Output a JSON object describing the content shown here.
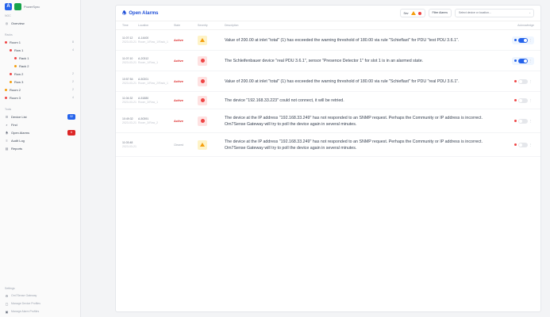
{
  "brand": {
    "name": "PowerSync"
  },
  "sidebar": {
    "sec1": "NOC",
    "overview": "Overview",
    "sec2": "Racks",
    "tree": [
      {
        "label": "Room 1",
        "indent": 0,
        "dot": "#ef4444",
        "count": "8"
      },
      {
        "label": "Row 1",
        "indent": 1,
        "dot": "#ef4444",
        "count": "4"
      },
      {
        "label": "Rack 1",
        "indent": 2,
        "dot": "#ef4444",
        "count": ""
      },
      {
        "label": "Rack 2",
        "indent": 2,
        "dot": "#f59e0b",
        "count": ""
      },
      {
        "label": "Row 2",
        "indent": 1,
        "dot": "#ef4444",
        "count": "2"
      },
      {
        "label": "Row 3",
        "indent": 1,
        "dot": "#f59e0b",
        "count": "2"
      },
      {
        "label": "Room 2",
        "indent": 0,
        "dot": "#f59e0b",
        "count": "2"
      },
      {
        "label": "Room 3",
        "indent": 0,
        "dot": "#ef4444",
        "count": "4"
      }
    ],
    "sec3": "Tools",
    "tools": [
      {
        "label": "Device List",
        "icon": "list-icon",
        "badge": "32",
        "badgeColor": "#2563eb"
      },
      {
        "label": "Find",
        "icon": "search-icon",
        "badge": "",
        "badgeColor": ""
      },
      {
        "label": "Open Alarms",
        "icon": "bell-icon",
        "badge": "6",
        "badgeColor": "#dc2626"
      },
      {
        "label": "Audit Log",
        "icon": "log-icon",
        "badge": "",
        "badgeColor": ""
      },
      {
        "label": "Reports",
        "icon": "report-icon",
        "badge": "",
        "badgeColor": ""
      }
    ],
    "sec4": "Settings",
    "footer": [
      "Om7Sense Gateway",
      "Manage Device Profiles",
      "Manage Alarm Profiles"
    ]
  },
  "header": {
    "title": "Open Alarms",
    "severity_label": "Sev",
    "filter_label": "Filter Alarms",
    "search_placeholder": "Select device or location..."
  },
  "table": {
    "columns": [
      "Time",
      "Location",
      "State",
      "Severity",
      "Description",
      "Acknowledge"
    ],
    "rows": [
      {
        "time": "11:07:12",
        "date": "2023-03-21",
        "loc": "A-14400",
        "locsub": "Room_1/Row_1/Rack_1",
        "state": "Active",
        "severity": "warning",
        "desc": "Value of 200.00 at inlet \"total\" (1) has exceeded the warning threshold of 180.00 via rule \"Schieflast\" for PDU \"test PDU 3.6.1\".",
        "ack": true
      },
      {
        "time": "11:07:10",
        "date": "2023-03-21",
        "loc": "A-20312",
        "locsub": "Room_1/Row_1",
        "state": "Active",
        "severity": "critical",
        "desc": "The Schleifenbauer device \"real PDU 3.6.1\", sensor \"Presence Detector 1\" for slot 1 is in an alarmed state.",
        "ack": true
      },
      {
        "time": "10:57:54",
        "date": "2023-03-21",
        "loc": "A-50201",
        "locsub": "Room_1/Row_2/Rack_1",
        "state": "Active",
        "severity": "critical",
        "desc": "Value of 200.00 at inlet \"total\" (1) has exceeded the warning threshold of 180.00 via rule \"Schieflast\" for PDU \"real PDU 3.6.1\".",
        "ack": false
      },
      {
        "time": "11:04:32",
        "date": "2023-03-21",
        "loc": "A-51880",
        "locsub": "Room_3/Row_1",
        "state": "Active",
        "severity": "critical",
        "desc": "The device \"192.168.33.223\" could not connect, it will be retried.",
        "ack": false
      },
      {
        "time": "10:49:32",
        "date": "2023-03-21",
        "loc": "A-50391",
        "locsub": "Room_3/Row_2",
        "state": "Active",
        "severity": "critical",
        "desc": "The device at the IP address \"192.168.33.249\" has not responded to an SNMP request. Perhaps the Community or IP address is incorrect. Om7Sense Gateway will try to poll the device again in several minutes.",
        "ack": false
      },
      {
        "time": "11:03:48",
        "date": "2023-03-21",
        "loc": "",
        "locsub": "",
        "state": "",
        "severity": "warning",
        "desc": "The device at the IP address \"192.168.33.249\" has not responded to an SNMP request. Perhaps the Community or IP address is incorrect. Om7Sense Gateway will try to poll the device again in several minutes.",
        "ack": false,
        "stateText": "Cleared"
      }
    ]
  }
}
